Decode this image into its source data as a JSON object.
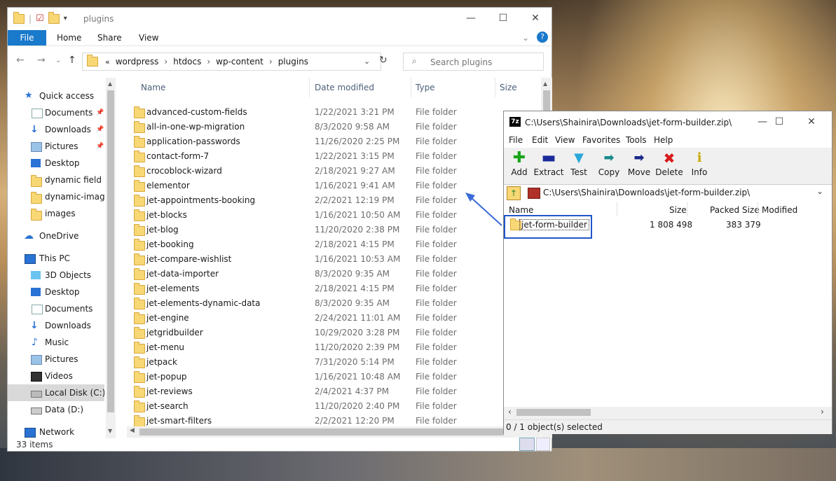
{
  "explorer": {
    "title": "plugins",
    "ribbon_tabs": [
      "File",
      "Home",
      "Share",
      "View"
    ],
    "breadcrumb": [
      "wordpress",
      "htdocs",
      "wp-content",
      "plugins"
    ],
    "search_placeholder": "Search plugins",
    "columns": {
      "name": "Name",
      "date": "Date modified",
      "type": "Type",
      "size": "Size"
    },
    "nav": {
      "quick_access": "Quick access",
      "documents": "Documents",
      "downloads": "Downloads",
      "pictures": "Pictures",
      "desktop": "Desktop",
      "dynamic_field": "dynamic field bl",
      "dynamic_image": "dynamic-image",
      "images": "images",
      "onedrive": "OneDrive",
      "this_pc": "This PC",
      "objects_3d": "3D Objects",
      "pc_desktop": "Desktop",
      "pc_documents": "Documents",
      "pc_downloads": "Downloads",
      "music": "Music",
      "pc_pictures": "Pictures",
      "videos": "Videos",
      "local_disk": "Local Disk (C:)",
      "data_disk": "Data (D:)",
      "network": "Network"
    },
    "files": [
      {
        "name": "advanced-custom-fields",
        "date": "1/22/2021 3:21 PM",
        "type": "File folder"
      },
      {
        "name": "all-in-one-wp-migration",
        "date": "8/3/2020 9:58 AM",
        "type": "File folder"
      },
      {
        "name": "application-passwords",
        "date": "11/26/2020 2:25 PM",
        "type": "File folder"
      },
      {
        "name": "contact-form-7",
        "date": "1/22/2021 3:15 PM",
        "type": "File folder"
      },
      {
        "name": "crocoblock-wizard",
        "date": "2/18/2021 9:27 AM",
        "type": "File folder"
      },
      {
        "name": "elementor",
        "date": "1/16/2021 9:41 AM",
        "type": "File folder"
      },
      {
        "name": "jet-appointments-booking",
        "date": "2/2/2021 12:19 PM",
        "type": "File folder"
      },
      {
        "name": "jet-blocks",
        "date": "1/16/2021 10:50 AM",
        "type": "File folder"
      },
      {
        "name": "jet-blog",
        "date": "11/20/2020 2:38 PM",
        "type": "File folder"
      },
      {
        "name": "jet-booking",
        "date": "2/18/2021 4:15 PM",
        "type": "File folder"
      },
      {
        "name": "jet-compare-wishlist",
        "date": "1/16/2021 10:53 AM",
        "type": "File folder"
      },
      {
        "name": "jet-data-importer",
        "date": "8/3/2020 9:35 AM",
        "type": "File folder"
      },
      {
        "name": "jet-elements",
        "date": "2/18/2021 4:15 PM",
        "type": "File folder"
      },
      {
        "name": "jet-elements-dynamic-data",
        "date": "8/3/2020 9:35 AM",
        "type": "File folder"
      },
      {
        "name": "jet-engine",
        "date": "2/24/2021 11:01 AM",
        "type": "File folder"
      },
      {
        "name": "jetgridbuilder",
        "date": "10/29/2020 3:28 PM",
        "type": "File folder"
      },
      {
        "name": "jet-menu",
        "date": "11/20/2020 2:39 PM",
        "type": "File folder"
      },
      {
        "name": "jetpack",
        "date": "7/31/2020 5:14 PM",
        "type": "File folder"
      },
      {
        "name": "jet-popup",
        "date": "1/16/2021 10:48 AM",
        "type": "File folder"
      },
      {
        "name": "jet-reviews",
        "date": "2/4/2021 4:37 PM",
        "type": "File folder"
      },
      {
        "name": "jet-search",
        "date": "11/20/2020 2:40 PM",
        "type": "File folder"
      },
      {
        "name": "jet-smart-filters",
        "date": "2/2/2021 12:20 PM",
        "type": "File folder"
      }
    ],
    "status": "33 items"
  },
  "zip": {
    "title": "C:\\Users\\Shainira\\Downloads\\jet-form-builder.zip\\",
    "menu": [
      "File",
      "Edit",
      "View",
      "Favorites",
      "Tools",
      "Help"
    ],
    "tools": [
      {
        "label": "Add",
        "icon": "add-icon"
      },
      {
        "label": "Extract",
        "icon": "extract-icon"
      },
      {
        "label": "Test",
        "icon": "test-icon"
      },
      {
        "label": "Copy",
        "icon": "copy-icon"
      },
      {
        "label": "Move",
        "icon": "move-icon"
      },
      {
        "label": "Delete",
        "icon": "delete-icon"
      },
      {
        "label": "Info",
        "icon": "info-icon"
      }
    ],
    "path": "C:\\Users\\Shainira\\Downloads\\jet-form-builder.zip\\",
    "columns": {
      "name": "Name",
      "size": "Size",
      "packed": "Packed Size",
      "modified": "Modified"
    },
    "item": {
      "name": "jet-form-builder",
      "size": "1 808 498",
      "packed": "383 379"
    },
    "status": "0 / 1 object(s) selected"
  },
  "colors": {
    "accent": "#1979ca",
    "highlight": "#2255cc",
    "arrow": "#3a6ad8"
  }
}
